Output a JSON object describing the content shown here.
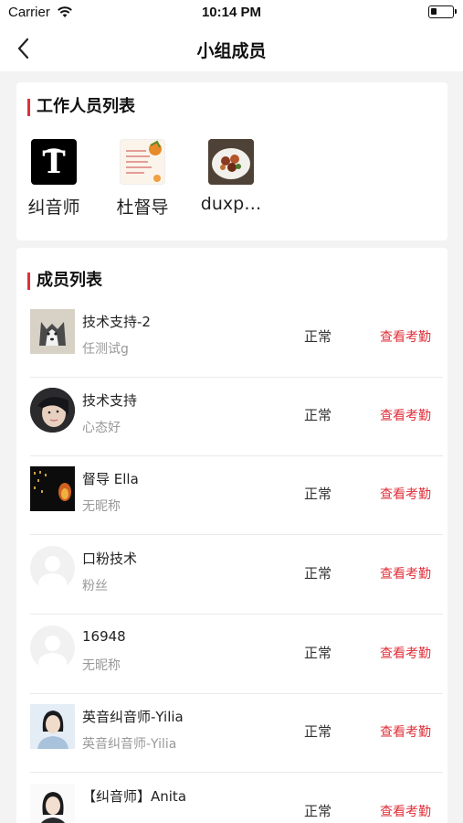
{
  "status_bar": {
    "carrier": "Carrier",
    "time": "10:14 PM"
  },
  "nav": {
    "title": "小组成员"
  },
  "staff_section": {
    "title": "工作人员列表",
    "items": [
      {
        "name": "纠音师"
      },
      {
        "name": "杜督导"
      },
      {
        "name": "duxp…"
      }
    ]
  },
  "members_section": {
    "title": "成员列表",
    "items": [
      {
        "name": "技术支持-2",
        "sub": "任测试g",
        "status": "正常",
        "action": "查看考勤"
      },
      {
        "name": "技术支持",
        "sub": "心态好",
        "status": "正常",
        "action": "查看考勤"
      },
      {
        "name": "督导 Ella",
        "sub": "无昵称",
        "status": "正常",
        "action": "查看考勤"
      },
      {
        "name": "口粉技术",
        "sub": "粉丝",
        "status": "正常",
        "action": "查看考勤"
      },
      {
        "name": "16948",
        "sub": "无昵称",
        "status": "正常",
        "action": "查看考勤"
      },
      {
        "name": "英音纠音师-Yilia",
        "sub": "英音纠音师-Yilia",
        "status": "正常",
        "action": "查看考勤"
      },
      {
        "name": "【纠音师】Anita",
        "sub": "",
        "status": "正常",
        "action": "查看考勤"
      }
    ]
  }
}
